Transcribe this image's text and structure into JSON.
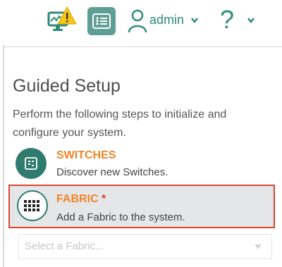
{
  "header": {
    "username": "admin",
    "help_symbol": "?",
    "icons": {
      "monitor": "monitor-alert-icon",
      "list": "list-icon",
      "user": "user-icon",
      "chevron": "chevron-down-icon"
    },
    "colors": {
      "accent": "#2f8a7b",
      "warning": "#f5c518",
      "list_bg": "#5f9e95"
    }
  },
  "guided_setup": {
    "title": "Guided Setup",
    "description": "Perform the following steps to initialize and configure your system.",
    "steps": [
      {
        "title": "SWITCHES",
        "subtitle": "Discover new Switches.",
        "icon": "switch-icon"
      },
      {
        "title": "FABRIC",
        "required_marker": "*",
        "subtitle": "Add a Fabric to the system.",
        "icon": "grid-icon",
        "highlighted": true
      }
    ],
    "fabric_select": {
      "placeholder": "Select a Fabric..."
    },
    "colors": {
      "step_title": "#f0852a",
      "highlight_border": "#d9472e",
      "icon_bg": "#2f7b6d"
    }
  }
}
